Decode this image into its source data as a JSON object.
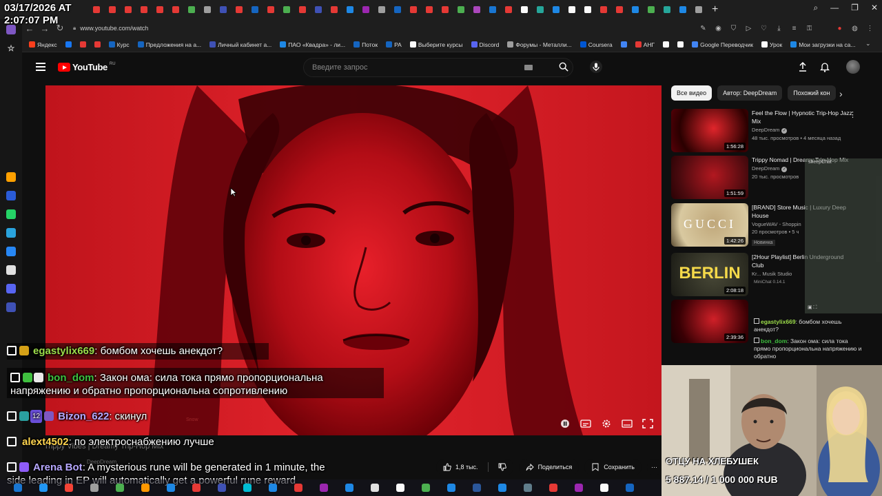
{
  "timestamp": {
    "date": "03/17/2026 AT",
    "time": "2:07:07 PM"
  },
  "browser": {
    "url": "www.youtube.com/watch",
    "tab_colors": [
      "#e53935",
      "#e53935",
      "#e53935",
      "#e53935",
      "#e53935",
      "#e53935",
      "#4caf50",
      "#9e9e9e",
      "#3f51b5",
      "#e53935",
      "#1565c0",
      "#e53935",
      "#4caf50",
      "#e53935",
      "#3f51b5",
      "#e53935",
      "#1e88e5",
      "#9c27b0",
      "#9e9e9e",
      "#1565c0",
      "#e53935",
      "#e53935",
      "#e53935",
      "#4caf50",
      "#ab47bc",
      "#1976d2",
      "#e53935",
      "#fafafa",
      "#26a69a",
      "#1e88e5",
      "#fafafa",
      "#fafafa",
      "#e53935",
      "#e53935",
      "#1e88e5",
      "#4caf50",
      "#26a69a",
      "#1e88e5",
      "#9e9e9e"
    ],
    "bookmarks": [
      {
        "label": "Яндекс",
        "color": "#fc3f1d"
      },
      {
        "label": "",
        "color": "#1877f2"
      },
      {
        "label": "",
        "color": "#e53935"
      },
      {
        "label": "",
        "color": "#e53935"
      },
      {
        "label": "Курс",
        "color": "#1565c0"
      },
      {
        "label": "Предложения на а...",
        "color": "#1565c0"
      },
      {
        "label": "Личный кабинет а...",
        "color": "#3f51b5"
      },
      {
        "label": "ПАО «Квадра» - ли...",
        "color": "#1e88e5"
      },
      {
        "label": "Поток",
        "color": "#1565c0"
      },
      {
        "label": "РА",
        "color": "#1565c0"
      },
      {
        "label": "Выберите курсы",
        "color": "#fafafa"
      },
      {
        "label": "Discord",
        "color": "#5865f2"
      },
      {
        "label": "Форумы - Металли...",
        "color": "#9e9e9e"
      },
      {
        "label": "Coursera",
        "color": "#0056d2"
      },
      {
        "label": "",
        "color": "#4285f4"
      },
      {
        "label": "АНГ",
        "color": "#e53935"
      },
      {
        "label": "",
        "color": "#fafafa"
      },
      {
        "label": "",
        "color": "#fafafa"
      },
      {
        "label": "Google Переводчик",
        "color": "#4285f4"
      },
      {
        "label": "Урок",
        "color": "#fafafa"
      },
      {
        "label": "Мои загрузки на са...",
        "color": "#1e88e5"
      }
    ],
    "sidebar_icons": [
      "#ffa000",
      "#2a5bd7",
      "#25d366",
      "#2aa3dd",
      "#2787f5",
      "#e0e0e0",
      "#5865f2",
      "#3f51b5"
    ]
  },
  "youtube": {
    "logo": "YouTube",
    "region": "RU",
    "search_placeholder": "Введите запрос",
    "chips": [
      "Все видео",
      "Автор: DeepDream",
      "Похожий кон"
    ],
    "recommendations": [
      {
        "title": "Feel the Flow | Hypnotic Trip-Hop Jazz Mix",
        "channel": "DeepDream",
        "verified": true,
        "meta": "48 тыс. просмотров • 4 месяца назад",
        "duration": "1:56:28",
        "badge": "",
        "colors": [
          "#2a0000",
          "#e0252b",
          "#5a0008"
        ]
      },
      {
        "title": "Trippy Nomad | Dreamy Trip-Hop Mix",
        "channel": "DeepDream",
        "verified": true,
        "meta": "20 тыс. просмотров",
        "duration": "1:51:59",
        "badge": "",
        "colors": [
          "#4a0a0e",
          "#b21820",
          "#2a0205"
        ]
      },
      {
        "title": "[BRAND] Store Music | Luxury Deep House",
        "channel": "VogueWAV - Shoppin",
        "verified": false,
        "meta": "20 просмотров • 5 ч",
        "duration": "1:42:26",
        "badge": "Новинка",
        "colors": [
          "#d9c9a0",
          "#bfa77a",
          "#5a4a30"
        ]
      },
      {
        "title": "[2Hour Playlist] Berlin Underground Club",
        "channel": "Kr... Musik Studio",
        "verified": false,
        "meta": "",
        "duration": "2:08:18",
        "badge": "",
        "colors": [
          "#2a2a20",
          "#4a4a38",
          "#1a1a14"
        ]
      },
      {
        "title": "",
        "channel": "",
        "verified": false,
        "meta": "",
        "duration": "2:39:36",
        "badge": "",
        "colors": [
          "#3a0004",
          "#d02028",
          "#1a0002"
        ]
      }
    ],
    "thumb_text_gucci": "GUCCI",
    "thumb_text_berlin": "BERLIN",
    "video_title": "Trippy Vibes | Dreamy Trip-Hop Mix",
    "channel_name": "DeepDream",
    "likes": "1,8 тыс.",
    "share_label": "Поделиться",
    "save_label": "Сохранить",
    "endcard_text": "Snow"
  },
  "sheepchat": {
    "header": "sheepChat",
    "minichat": "MiniChat 0.14.1",
    "messages": [
      {
        "user": "egastylix669",
        "text": ": бомбом хочешь анекдот?"
      },
      {
        "user": "bon_dom",
        "text": ": Закон ома: сила тока прямо пропорциональна напряжению и обратно"
      }
    ]
  },
  "webcam": {
    "line1": "ОТЦУ НА ХЛЕБУШЕК",
    "line2": "5 887.14 / 1 000 000 RUB"
  },
  "chat": [
    {
      "user": "egastylix669",
      "color": "#9cdc4a",
      "text": ": бомбом хочешь анекдот?",
      "badges": [
        "#d4a017"
      ],
      "num": ""
    },
    {
      "user": "bon_dom",
      "color": "#3fbf3f",
      "text": ": Закон ома: сила тока прямо пропорциональна",
      "text2": "напряжению и обратно пропорциональна сопротивлению",
      "badges": [
        "#3fbf3f",
        "#e8e8e8"
      ],
      "num": ""
    },
    {
      "user": "Bizon_622",
      "color": "#b7a8ff",
      "text": ": скинул",
      "badges": [
        "#2aa0a0"
      ],
      "num": "12"
    },
    {
      "user": "alext4502",
      "color": "#ffd54f",
      "text": ": по электроснабжению лучше",
      "badges": [],
      "num": ""
    },
    {
      "user": "Arena Bot",
      "color": "#b7a8ff",
      "text": ": A mysterious rune will be generated in 1 minute, the",
      "text2": "side leading in EP will automatically get a powerful rune reward",
      "badges": [
        "#8e5cf7"
      ],
      "num": ""
    }
  ],
  "taskbar_icons": [
    "#1976d2",
    "#2196f3",
    "#f44336",
    "#9e9e9e",
    "#4caf50",
    "#ff9800",
    "#1e88e5",
    "#e53935",
    "#3f51b5",
    "#00bcd4",
    "#1e88e5",
    "#e53935",
    "#9c27b0",
    "#1e88e5",
    "#e0e0e0",
    "#fafafa",
    "#4caf50",
    "#1e88e5",
    "#2b579a",
    "#1e88e5",
    "#607d8b",
    "#e53935",
    "#9c27b0",
    "#fafafa",
    "#1565c0"
  ]
}
